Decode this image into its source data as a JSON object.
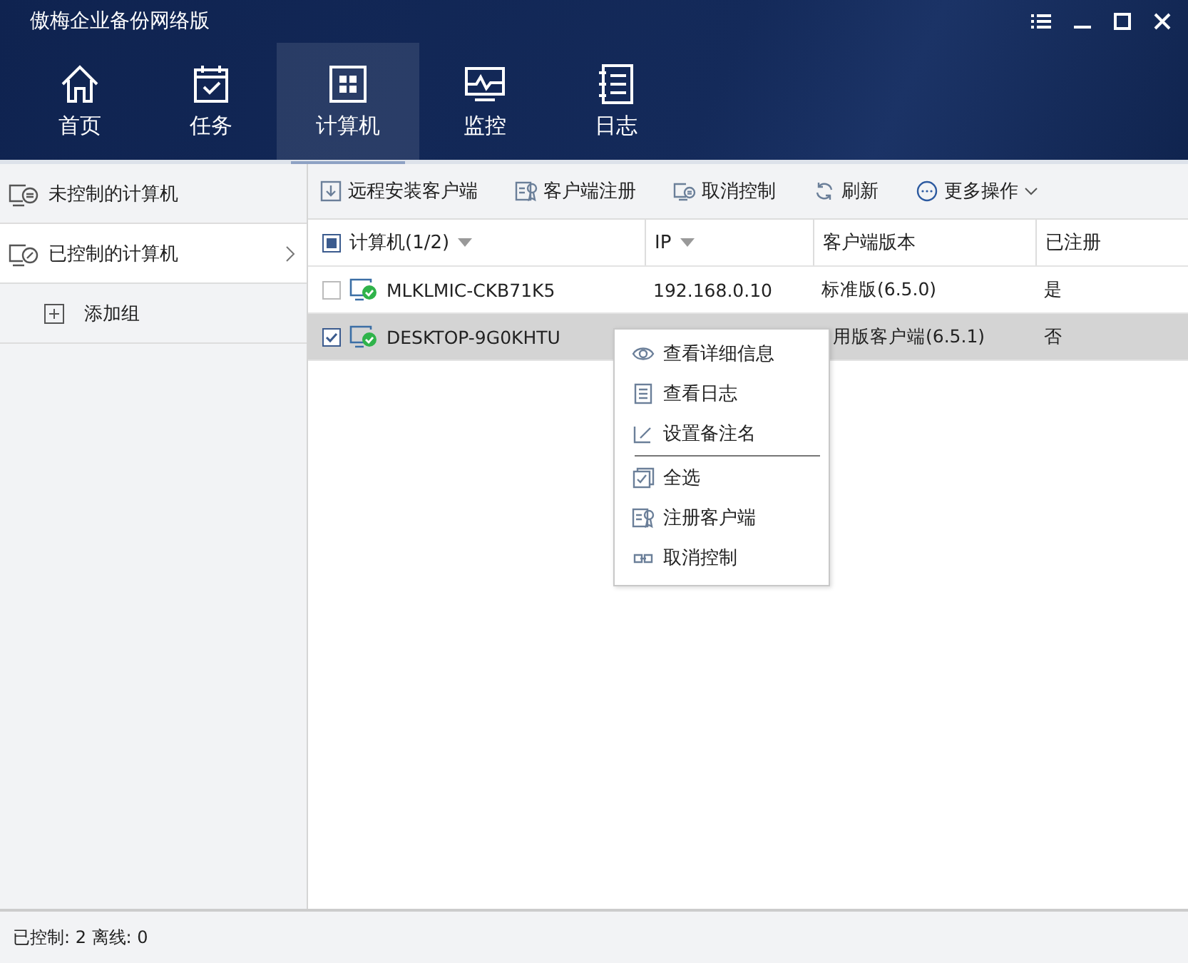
{
  "window": {
    "title": "傲梅企业备份网络版"
  },
  "nav": [
    {
      "label": "首页",
      "kind": "home",
      "selected": false
    },
    {
      "label": "任务",
      "kind": "task",
      "selected": false
    },
    {
      "label": "计算机",
      "kind": "computer",
      "selected": true
    },
    {
      "label": "监控",
      "kind": "monitor",
      "selected": false
    },
    {
      "label": "日志",
      "kind": "log",
      "selected": false
    }
  ],
  "sidebar": {
    "items": [
      {
        "label": "未控制的计算机",
        "kind": "uncontrolled",
        "selected": false
      },
      {
        "label": "已控制的计算机",
        "kind": "controlled",
        "selected": true,
        "expandable": true
      },
      {
        "label": "添加组",
        "kind": "add",
        "selected": false
      }
    ]
  },
  "toolbar": [
    {
      "label": "远程安装客户端",
      "kind": "install"
    },
    {
      "label": "客户端注册",
      "kind": "register"
    },
    {
      "label": "取消控制",
      "kind": "uncontrol"
    },
    {
      "label": "刷新",
      "kind": "refresh"
    },
    {
      "label": "更多操作",
      "kind": "more"
    }
  ],
  "table": {
    "select_all_partial": true,
    "columns": [
      {
        "label": "计算机(1/2)",
        "sortable": true
      },
      {
        "label": "IP",
        "sortable": true
      },
      {
        "label": "客户端版本"
      },
      {
        "label": "已注册"
      }
    ],
    "rows": [
      {
        "selected": false,
        "name": "MLKLMIC-CKB71K5",
        "ip": "192.168.0.10",
        "version": "标准版(6.5.0)",
        "registered": "是"
      },
      {
        "selected": true,
        "name": "DESKTOP-9G0KHTU",
        "version": "用版客户端(6.5.1)",
        "registered": "否"
      }
    ]
  },
  "context_menu": [
    {
      "label": "查看详细信息",
      "kind": "view"
    },
    {
      "label": "查看日志",
      "kind": "log"
    },
    {
      "label": "设置备注名",
      "kind": "rename",
      "divider_after": true
    },
    {
      "label": "全选",
      "kind": "selectall"
    },
    {
      "label": "注册客户端",
      "kind": "register"
    },
    {
      "label": "取消控制",
      "kind": "uncontrol"
    }
  ],
  "status_bar": "已控制: 2 离线: 0"
}
